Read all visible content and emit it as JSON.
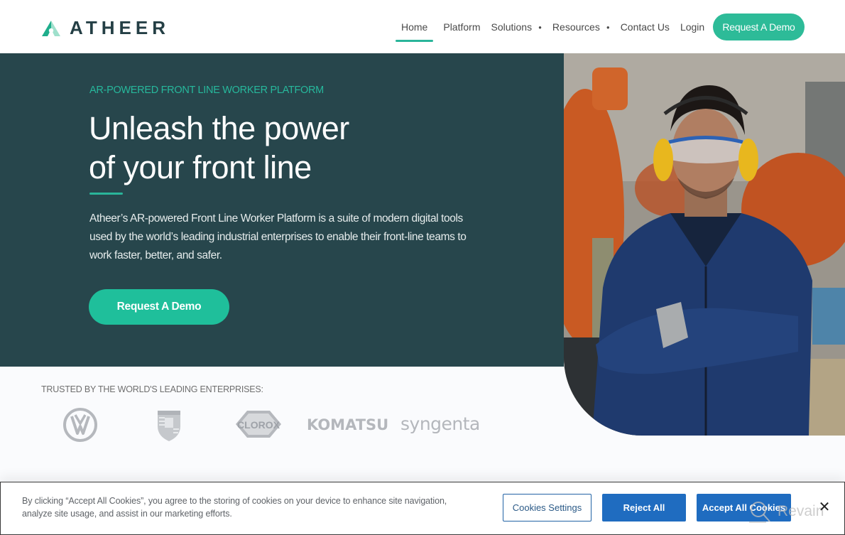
{
  "header": {
    "brand_name": "ATHEER",
    "nav": [
      {
        "label": "Home",
        "active": true,
        "has_dropdown": false
      },
      {
        "label": "Platform",
        "active": false,
        "has_dropdown": false
      },
      {
        "label": "Solutions",
        "active": false,
        "has_dropdown": true
      },
      {
        "label": "Resources",
        "active": false,
        "has_dropdown": true
      },
      {
        "label": "Contact Us",
        "active": false,
        "has_dropdown": false
      },
      {
        "label": "Login",
        "active": false,
        "has_dropdown": false
      }
    ],
    "cta_label": "Request A Demo",
    "dropdown_glyph": "▼"
  },
  "hero": {
    "eyebrow": "AR-POWERED FRONT LINE WORKER PLATFORM",
    "headline_line1": "Unleash the power",
    "headline_line2": "of your front line",
    "description": "Atheer’s AR-powered Front Line Worker Platform is a suite of modern digital tools used by the world’s leading industrial enterprises to enable their front-line teams to work faster, better, and safer.",
    "cta_label": "Request A Demo",
    "image_alt": "Factory worker wearing safety glasses and yellow ear protection with arms crossed"
  },
  "trusted": {
    "label": "TRUSTED BY THE WORLD'S LEADING ENTERPRISES:",
    "logos": [
      {
        "name": "Volkswagen",
        "icon": "vw-logo"
      },
      {
        "name": "Porsche",
        "icon": "porsche-crest-logo"
      },
      {
        "name": "Clorox",
        "text": "CLOROX",
        "icon": "clorox-logo"
      },
      {
        "name": "Komatsu",
        "text": "KOMATSU",
        "icon": "komatsu-logo"
      },
      {
        "name": "Syngenta",
        "text": "syngenta",
        "icon": "syngenta-logo"
      }
    ]
  },
  "cookie_banner": {
    "text": "By clicking “Accept All Cookies”, you agree to the storing of cookies on your device to enhance site navigation, analyze site usage, and assist in our marketing efforts.",
    "settings_label": "Cookies Settings",
    "reject_label": "Reject All",
    "accept_label": "Accept All Cookies",
    "close_glyph": "✕"
  },
  "watermark": {
    "text": "Revain"
  },
  "colors": {
    "brand_teal": "#2dbb98",
    "hero_bg": "#27464c",
    "logo_dark": "#243f45",
    "cookie_blue": "#1f6cc0",
    "logo_gray": "#b5b8bd"
  }
}
